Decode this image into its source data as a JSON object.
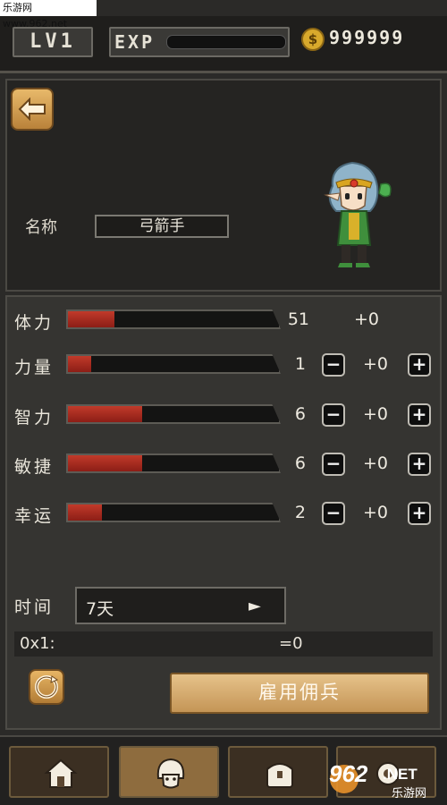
{
  "watermark_top": "乐游网 www.962.net",
  "header": {
    "level": "LV1",
    "exp_label": "EXP",
    "exp_progress": 0.0,
    "gold": "999999",
    "coin_symbol": "$"
  },
  "character": {
    "name_label": "名称",
    "name_value": "弓箭手"
  },
  "stats": [
    {
      "label": "体力",
      "value": "51",
      "bonus": "+0",
      "fill": 0.22,
      "adjustable": false
    },
    {
      "label": "力量",
      "value": "1",
      "bonus": "+0",
      "fill": 0.11,
      "adjustable": true
    },
    {
      "label": "智力",
      "value": "6",
      "bonus": "+0",
      "fill": 0.35,
      "adjustable": true
    },
    {
      "label": "敏捷",
      "value": "6",
      "bonus": "+0",
      "fill": 0.35,
      "adjustable": true
    },
    {
      "label": "幸运",
      "value": "2",
      "bonus": "+0",
      "fill": 0.16,
      "adjustable": true
    }
  ],
  "controls": {
    "minus": "−",
    "plus": "+"
  },
  "time": {
    "label": "时间",
    "value": "7天",
    "arrow": "►"
  },
  "formula": {
    "left": "0x1:",
    "right": "=0"
  },
  "hire_button": "雇用佣兵",
  "bottom_tabs": [
    {
      "name": "home",
      "icon": "house-icon",
      "active": false
    },
    {
      "name": "mercenary",
      "icon": "character-icon",
      "active": true
    },
    {
      "name": "inventory",
      "icon": "chest-icon",
      "active": false
    },
    {
      "name": "settings",
      "icon": "gear-icon",
      "active": false
    }
  ],
  "watermark_corner": {
    "brand": "962",
    "suffix": ".NET",
    "sub": "乐游网"
  },
  "colors": {
    "bar_fill": "#b0281c",
    "hire_button": "#d4aa6c",
    "active_tab": "#8e6c3e"
  }
}
